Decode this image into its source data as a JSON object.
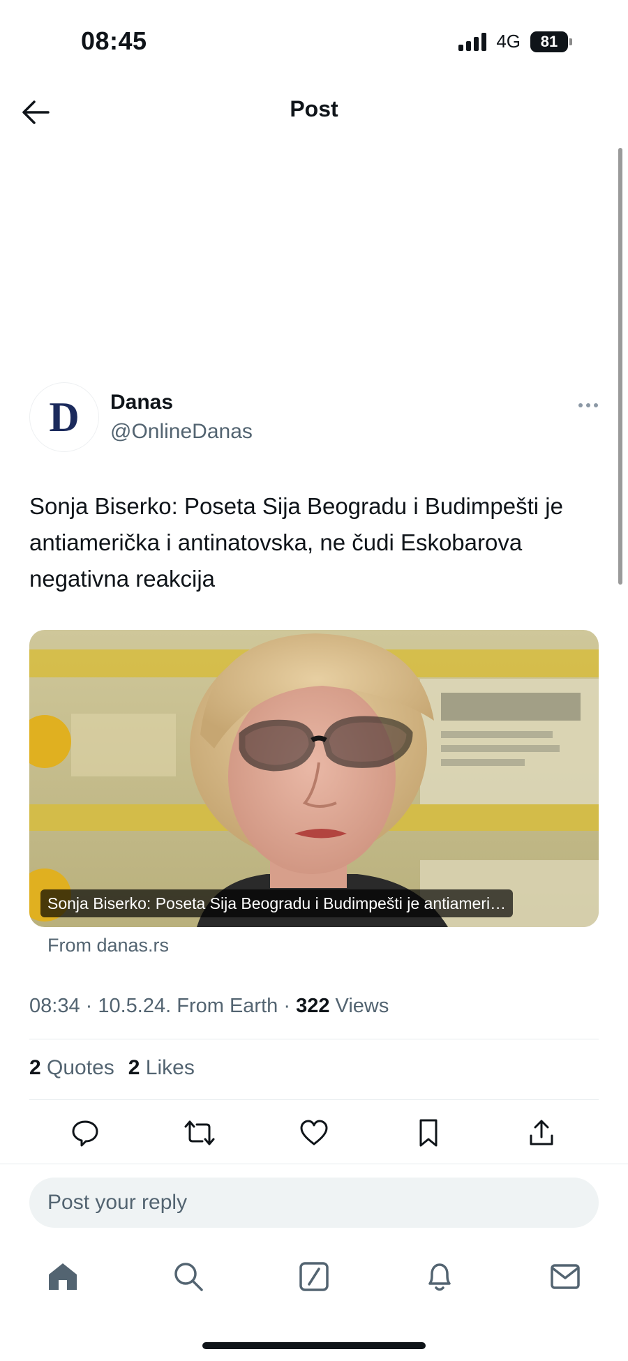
{
  "status_bar": {
    "time": "08:45",
    "network": "4G",
    "battery": "81"
  },
  "header": {
    "title": "Post",
    "back_icon": "arrow-left-icon"
  },
  "post": {
    "author": {
      "avatar_letter": "D",
      "name": "Danas",
      "handle": "@OnlineDanas"
    },
    "more_icon": "more-horizontal-icon",
    "text": "Sonja Biserko: Poseta Sija Beogradu i Budimpešti je antiamerička i antinatovska, ne čudi Eskobarova negativna reakcija",
    "card": {
      "caption": "Sonja Biserko: Poseta Sija Beogradu i Budimpešti je antiameri…",
      "source": "From danas.rs"
    },
    "meta": {
      "time": "08:34",
      "date": "10.5.24.",
      "location": "From Earth",
      "views_count": "322",
      "views_label": "Views"
    },
    "stats": {
      "quotes_count": "2",
      "quotes_label": "Quotes",
      "likes_count": "2",
      "likes_label": "Likes"
    },
    "actions": [
      "reply-icon",
      "repost-icon",
      "like-icon",
      "bookmark-icon",
      "share-icon"
    ]
  },
  "reply": {
    "placeholder": "Post your reply"
  },
  "bottom_nav": [
    "home-icon",
    "search-icon",
    "grok-icon",
    "notifications-icon",
    "messages-icon"
  ],
  "colors": {
    "text": "#0f1419",
    "secondary": "#536471",
    "divider": "#e6ebee",
    "reply_bg": "#eff3f4",
    "avatar_letter": "#1b2a5c"
  }
}
